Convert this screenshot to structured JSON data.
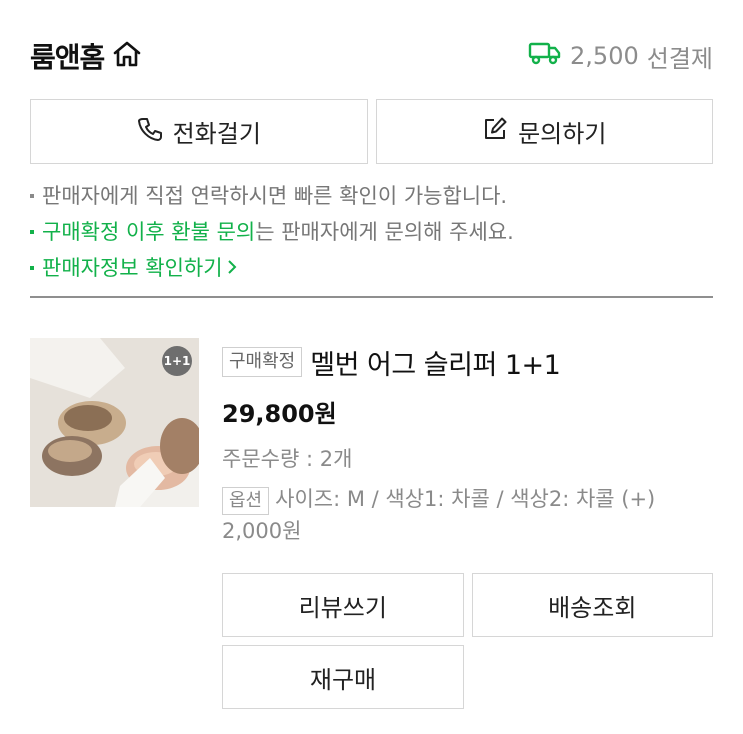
{
  "store": {
    "name": "룸앤홈"
  },
  "shipping": {
    "fee": "2,500",
    "payment": "선결제"
  },
  "contact": {
    "call_label": "전화걸기",
    "inquiry_label": "문의하기"
  },
  "notices": {
    "line1": "판매자에게 직접 연락하시면 빠른 확인이 가능합니다.",
    "line2_highlight": "구매확정 이후 환불 문의",
    "line2_rest": "는 판매자에게 문의해 주세요.",
    "line3": "판매자정보 확인하기"
  },
  "order": {
    "image_badge": "1+1",
    "status": "구매확정",
    "product_name": "멜번 어그 슬리퍼 1+1",
    "price": "29,800원",
    "quantity": "주문수량 : 2개",
    "option_label": "옵션",
    "option_text": "사이즈: M / 색상1: 차콜 / 색상2: 차콜 (+) 2,000원"
  },
  "actions": {
    "review": "리뷰쓰기",
    "tracking": "배송조회",
    "rebuy": "재구매"
  },
  "colors": {
    "accent_green": "#12b14a",
    "border": "#d6d6d6",
    "muted_text": "#8a8a8a"
  }
}
